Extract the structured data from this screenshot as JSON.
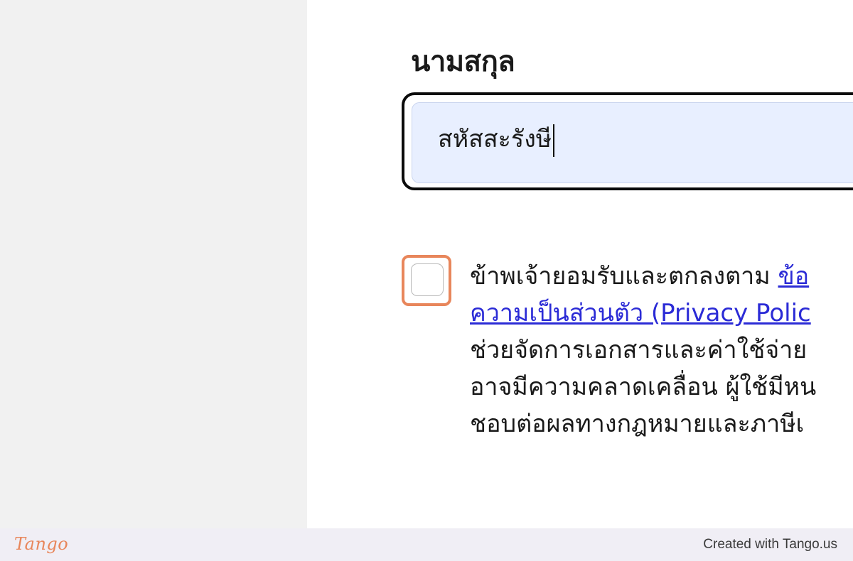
{
  "form": {
    "surname_label": "นามสกุล",
    "surname_value": "สหัสสะรังษี"
  },
  "consent": {
    "line1_text": "ข้าพเจ้ายอมรับและตกลงตาม ",
    "line1_link": "ข้อ",
    "line2_link": "ความเป็นส่วนตัว (Privacy Polic",
    "line3": "ช่วยจัดการเอกสารและค่าใช้จ่าย",
    "line4": "อาจมีความคลาดเคลื่อน ผู้ใช้มีหน",
    "line5": "ชอบต่อผลทางกฎหมายและภาษีเ"
  },
  "footer": {
    "logo": "Tango",
    "credit": "Created with Tango.us"
  },
  "colors": {
    "highlight": "#e8865b",
    "link": "#2b2bd6",
    "input_bg": "#e8efff"
  }
}
